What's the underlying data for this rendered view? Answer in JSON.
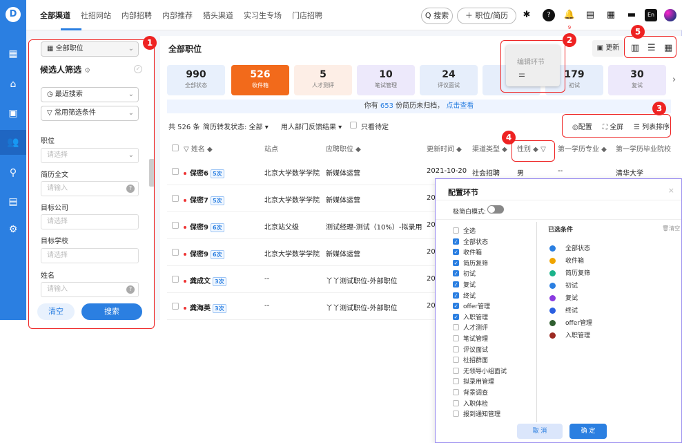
{
  "nav": {
    "logo": "D",
    "items": [
      "▦",
      "⌂",
      "▣",
      "👥",
      "⚲",
      "▤",
      "⚙"
    ]
  },
  "topbar": {
    "tabs": [
      "全部渠道",
      "社招网站",
      "内部招聘",
      "内部推荐",
      "猎头渠道",
      "实习生专场",
      "门店招聘"
    ],
    "search_label": "Q 搜索",
    "add_label": "＋ 职位/简历",
    "notif_count": "9",
    "lang": "En"
  },
  "filter": {
    "position_select": "全部职位",
    "heading": "候选人筛选",
    "recent_search": "最近搜索",
    "common_filter": "常用筛选条件",
    "fields": [
      {
        "label": "职位",
        "placeholder": "请选择"
      },
      {
        "label": "简历全文",
        "placeholder": "请输入"
      },
      {
        "label": "目标公司",
        "placeholder": "请选择"
      },
      {
        "label": "目标学校",
        "placeholder": "请选择"
      },
      {
        "label": "姓名",
        "placeholder": "请输入"
      }
    ],
    "clear": "清空",
    "search": "搜索"
  },
  "main": {
    "title": "全部职位",
    "update": "更新",
    "stats": [
      {
        "num": "990",
        "label": "全部状态"
      },
      {
        "num": "526",
        "label": "收件箱"
      },
      {
        "num": "5",
        "label": "人才测评"
      },
      {
        "num": "10",
        "label": "笔试管理"
      },
      {
        "num": "24",
        "label": "评议面试"
      },
      {
        "num": "",
        "label": ""
      },
      {
        "num": "179",
        "label": "初试"
      },
      {
        "num": "30",
        "label": "复试"
      }
    ],
    "notice_a": "你有",
    "notice_num": "653",
    "notice_b": "份简历未归档，",
    "notice_link": "点击查看",
    "total": "共 526 条",
    "forward_status": "简历转发状态: 全部 ▾",
    "dept_feedback": "用人部门反馈结果 ▾",
    "only_pending": "只看待定",
    "config": "配置",
    "fullscreen": "全屏",
    "column_sort": "列表排序",
    "columns": [
      "姓名 ◆",
      "站点",
      "应聘职位 ◆",
      "更新时间 ◆",
      "渠道类型 ◆",
      "性别 ◆",
      "第一学历专业 ◆",
      "第一学历毕业院校"
    ],
    "rows": [
      {
        "name": "保密6",
        "times": "5次",
        "site": "北京大学数学学院",
        "job": "新媒体运营",
        "time": "2021-10-20",
        "channel": "社会招聘",
        "gender": "男",
        "major": "--",
        "school": "清华大学"
      },
      {
        "name": "保密7",
        "times": "5次",
        "site": "北京大学数学学院",
        "job": "新媒体运营",
        "time": "20",
        "channel": "",
        "gender": "",
        "major": "",
        "school": ""
      },
      {
        "name": "保密9",
        "times": "6次",
        "site": "北京站父级",
        "job": "测试经理-测试（10%）-拟录用",
        "time": "20",
        "channel": "",
        "gender": "",
        "major": "",
        "school": ""
      },
      {
        "name": "保密9",
        "times": "6次",
        "site": "北京大学数学学院",
        "job": "新媒体运营",
        "time": "20",
        "channel": "",
        "gender": "",
        "major": "",
        "school": ""
      },
      {
        "name": "龚成文",
        "times": "3次",
        "site": "--",
        "job": "丫丫测试职位-外部职位",
        "time": "20",
        "channel": "",
        "gender": "",
        "major": "",
        "school": ""
      },
      {
        "name": "龚海英",
        "times": "3次",
        "site": "--",
        "job": "丫丫测试职位-外部职位",
        "time": "20",
        "channel": "",
        "gender": "",
        "major": "",
        "school": ""
      }
    ],
    "edit_popup": "编辑环节"
  },
  "callouts": [
    "1",
    "2",
    "3",
    "4",
    "5"
  ],
  "modal": {
    "title": "配置环节",
    "mode_label": "极简白模式:",
    "options": [
      {
        "label": "全选",
        "on": false
      },
      {
        "label": "全部状态",
        "on": true
      },
      {
        "label": "收件箱",
        "on": true
      },
      {
        "label": "简历复筛",
        "on": true
      },
      {
        "label": "初试",
        "on": true
      },
      {
        "label": "复试",
        "on": true
      },
      {
        "label": "终试",
        "on": true
      },
      {
        "label": "offer管理",
        "on": true
      },
      {
        "label": "入职管理",
        "on": true
      },
      {
        "label": "人才测评",
        "on": false
      },
      {
        "label": "笔试管理",
        "on": false
      },
      {
        "label": "评议面试",
        "on": false
      },
      {
        "label": "社招群面",
        "on": false
      },
      {
        "label": "无领导小组面试",
        "on": false
      },
      {
        "label": "拟录用管理",
        "on": false
      },
      {
        "label": "背景调查",
        "on": false
      },
      {
        "label": "入职体检",
        "on": false
      },
      {
        "label": "报到通知管理",
        "on": false
      }
    ],
    "selected_title": "已选条件",
    "clear": "清空",
    "selected": [
      {
        "label": "全部状态",
        "color": "#2b7fe1"
      },
      {
        "label": "收件箱",
        "color": "#f0a500"
      },
      {
        "label": "简历复筛",
        "color": "#1bb38a"
      },
      {
        "label": "初试",
        "color": "#2b7fe1"
      },
      {
        "label": "复试",
        "color": "#8a3be0"
      },
      {
        "label": "终试",
        "color": "#2b5fe1"
      },
      {
        "label": "offer管理",
        "color": "#2f5e2f"
      },
      {
        "label": "入职管理",
        "color": "#9c2a22"
      }
    ],
    "cancel": "取 消",
    "ok": "确 定"
  }
}
